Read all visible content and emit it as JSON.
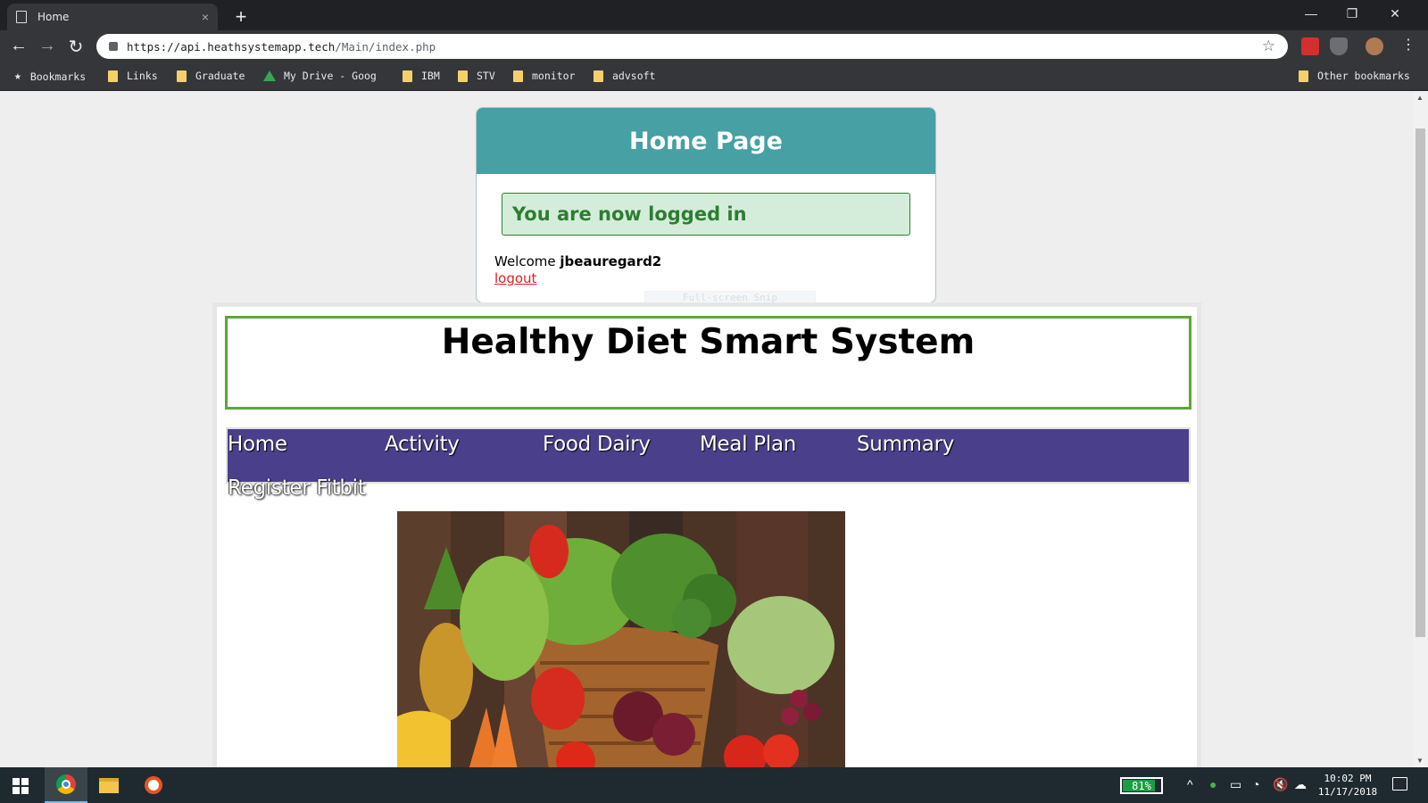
{
  "browser": {
    "tab_title": "Home",
    "tab_close": "×",
    "new_tab": "+",
    "url_host": "https://api.heathsystemapp.tech",
    "url_path": "/Main/index.php",
    "window_controls": {
      "minimize": "—",
      "restore": "❐",
      "close": "✕"
    },
    "nav": {
      "back": "←",
      "forward": "→",
      "reload": "↻"
    }
  },
  "bookmarks": {
    "items": [
      {
        "label": "Bookmarks",
        "icon": "star-icon"
      },
      {
        "label": "Links",
        "icon": "folder-icon"
      },
      {
        "label": "Graduate",
        "icon": "folder-icon"
      },
      {
        "label": "My Drive - Goog",
        "icon": "google-drive-icon"
      },
      {
        "label": "IBM",
        "icon": "folder-icon"
      },
      {
        "label": "STV",
        "icon": "folder-icon"
      },
      {
        "label": "monitor",
        "icon": "folder-icon"
      },
      {
        "label": "advsoft",
        "icon": "folder-icon"
      }
    ],
    "other": "Other bookmarks"
  },
  "card": {
    "title": "Home Page",
    "success": "You are now logged in",
    "welcome_prefix": "Welcome ",
    "username": "jbeauregard2",
    "logout": "logout",
    "snip_overlay": "Full-screen Snip"
  },
  "site": {
    "title": "Healthy Diet Smart System",
    "nav": [
      "Home",
      "Activity",
      "Food Dairy",
      "Meal Plan",
      "Summary",
      "Register Fitbit"
    ],
    "nav_color": "#4a3f8a",
    "title_border_color": "#5aa832"
  },
  "taskbar": {
    "battery": "81%",
    "battery_level": 0.81,
    "time": "10:02 PM",
    "date": "11/17/2018"
  }
}
